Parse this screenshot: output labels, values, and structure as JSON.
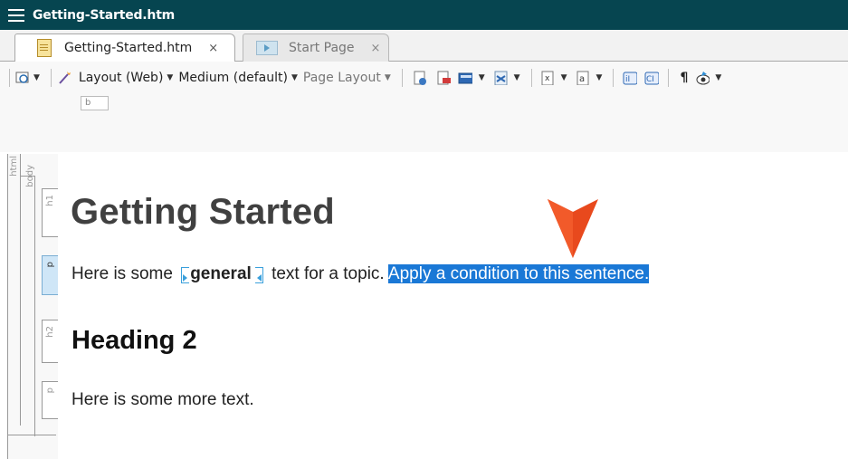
{
  "window": {
    "title": "Getting-Started.htm"
  },
  "tabs": [
    {
      "label": "Getting-Started.htm",
      "close": "×",
      "active": true
    },
    {
      "label": "Start Page",
      "close": "×",
      "active": false
    }
  ],
  "toolbar": {
    "layout_label": "Layout (Web)",
    "medium_label": "Medium (default)",
    "page_layout_label": "Page Layout",
    "pilcrow": "¶"
  },
  "ruler_tag": "b",
  "structure_bars": {
    "html": "html",
    "body": "body",
    "tags": [
      "h1",
      "p",
      "h2",
      "p"
    ]
  },
  "document": {
    "heading1": "Getting Started",
    "paragraph1": {
      "before": "Here is some ",
      "bold": "general",
      "after": " text for a topic. ",
      "selected": "Apply a condition to this sentence."
    },
    "heading2": "Heading 2",
    "paragraph2": "Here is some more text."
  },
  "colors": {
    "titlebar": "#064550",
    "selection": "#1a78d6",
    "pointer": "#e8491d"
  }
}
